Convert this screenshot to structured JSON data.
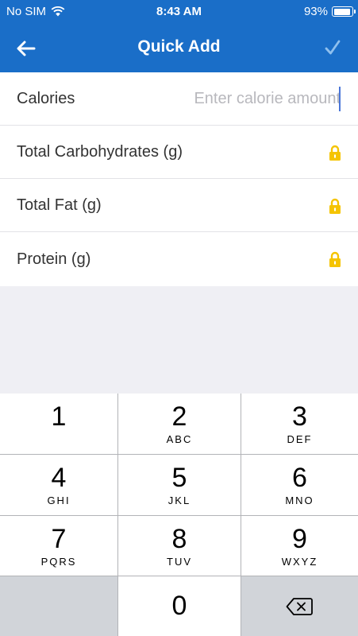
{
  "status_bar": {
    "carrier": "No SIM",
    "time": "8:43 AM",
    "battery_percent": "93%",
    "battery_level": 0.93
  },
  "nav": {
    "title": "Quick Add",
    "back_icon": "arrow-left-icon",
    "confirm_icon": "checkmark-icon"
  },
  "form": {
    "rows": [
      {
        "label": "Calories",
        "placeholder": "Enter calorie amount",
        "value": ""
      },
      {
        "label": "Total Carbohydrates (g)",
        "locked": true
      },
      {
        "label": "Total Fat (g)",
        "locked": true
      },
      {
        "label": "Protein (g)",
        "locked": true
      }
    ]
  },
  "keypad": {
    "keys": [
      {
        "num": "1",
        "letters": ""
      },
      {
        "num": "2",
        "letters": "ABC"
      },
      {
        "num": "3",
        "letters": "DEF"
      },
      {
        "num": "4",
        "letters": "GHI"
      },
      {
        "num": "5",
        "letters": "JKL"
      },
      {
        "num": "6",
        "letters": "MNO"
      },
      {
        "num": "7",
        "letters": "PQRS"
      },
      {
        "num": "8",
        "letters": "TUV"
      },
      {
        "num": "9",
        "letters": "WXYZ"
      },
      {
        "num": "0",
        "letters": ""
      }
    ],
    "delete_icon": "backspace-icon"
  },
  "colors": {
    "header": "#1a6ec8",
    "lock": "#f5c400",
    "check": "#8fc0ee"
  }
}
